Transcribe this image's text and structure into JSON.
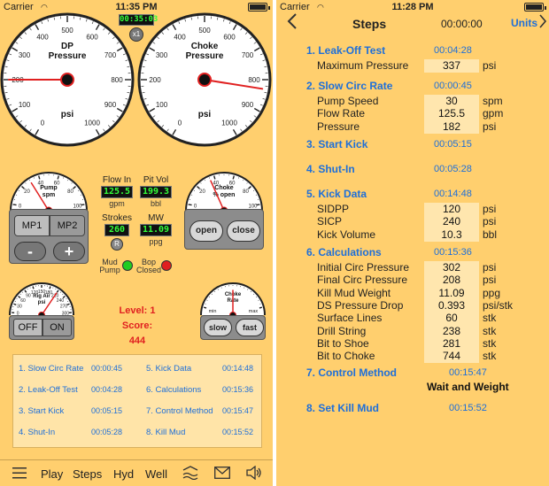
{
  "left_screen": {
    "status_bar": {
      "carrier": "Carrier",
      "time": "11:35 PM"
    },
    "timer": "00:35:03",
    "speed_multiplier": "x1",
    "dp_gauge": {
      "title_line1": "DP",
      "title_line2": "Pressure",
      "unit": "psi",
      "ticks": [
        "0",
        "100",
        "200",
        "300",
        "400",
        "500",
        "600",
        "700",
        "800",
        "900",
        "1000"
      ],
      "value": 200
    },
    "choke_gauge": {
      "title_line1": "Choke",
      "title_line2": "Pressure",
      "unit": "psi",
      "ticks": [
        "0",
        "100",
        "200",
        "300",
        "400",
        "500",
        "600",
        "700",
        "800",
        "900",
        "1000"
      ],
      "value": 830
    },
    "pump_gauge": {
      "title_line1": "Pump",
      "title_line2": "spm",
      "ticks": [
        "0",
        "20",
        "40",
        "60",
        "80",
        "100"
      ],
      "value": 30
    },
    "choke_open_gauge": {
      "title_line1": "Choke",
      "title_line2": "% open",
      "ticks": [
        "0",
        "20",
        "40",
        "60",
        "80",
        "100"
      ],
      "value": 35
    },
    "rig_air_gauge": {
      "title_line1": "Rig Air",
      "title_line2": "psi",
      "ticks": [
        "0",
        "30",
        "60",
        "90",
        "120",
        "150",
        "180",
        "210",
        "240",
        "270",
        "300"
      ],
      "value": 210
    },
    "choke_rate_gauge": {
      "title_line1": "Choke",
      "title_line2": "Rate",
      "min_label": "min",
      "max_label": "max",
      "value": 50
    },
    "flow_in": {
      "label": "Flow In",
      "value": "125.5",
      "unit": "gpm"
    },
    "pit_vol": {
      "label": "Pit Vol",
      "value": "199.3",
      "unit": "bbl"
    },
    "strokes": {
      "label": "Strokes",
      "value": "260",
      "reset_label": "R"
    },
    "mw": {
      "label": "MW",
      "value": "11.09",
      "unit": "ppg"
    },
    "mud_pump_led": {
      "label_line1": "Mud",
      "label_line2": "Pump",
      "color": "#22cc22"
    },
    "bop_closed_led": {
      "label_line1": "Bop",
      "label_line2": "Closed",
      "color": "#e02020"
    },
    "pump_controls": {
      "mp1": "MP1",
      "mp2": "MP2",
      "minus": "-",
      "plus": "+"
    },
    "choke_controls": {
      "open": "open",
      "close": "close"
    },
    "rig_air_toggle": {
      "off": "OFF",
      "on": "ON"
    },
    "choke_rate_controls": {
      "slow": "slow",
      "fast": "fast"
    },
    "level": {
      "label": "Level:",
      "value": "1"
    },
    "score": {
      "label": "Score:",
      "value": "444"
    },
    "accent_red": "#e02020",
    "steps": [
      {
        "label": "1. Slow Circ Rate",
        "time": "00:00:45"
      },
      {
        "label": "2. Leak-Off Test",
        "time": "00:04:28"
      },
      {
        "label": "3. Start Kick",
        "time": "00:05:15"
      },
      {
        "label": "4. Shut-In",
        "time": "00:05:28"
      },
      {
        "label": "5. Kick Data",
        "time": "00:14:48"
      },
      {
        "label": "6. Calculations",
        "time": "00:15:36"
      },
      {
        "label": "7. Control Method",
        "time": "00:15:47"
      },
      {
        "label": "8. Kill Mud",
        "time": "00:15:52"
      }
    ],
    "tab_bar": {
      "menu_icon": "menu-icon",
      "play": "Play",
      "steps": "Steps",
      "hyd": "Hyd",
      "well": "Well"
    }
  },
  "right_screen": {
    "status_bar": {
      "carrier": "Carrier",
      "time": "11:28 PM"
    },
    "nav": {
      "back_icon": "chevron-left-icon",
      "title": "Steps",
      "timer": "00:00:00",
      "units": "Units",
      "forward_icon": "chevron-right-icon"
    },
    "sections": [
      {
        "title": "1. Leak-Off Test",
        "time": "00:04:28",
        "rows": [
          {
            "label": "Maximum Pressure",
            "value": "337",
            "unit": "psi"
          }
        ]
      },
      {
        "title": "2. Slow Circ Rate",
        "time": "00:00:45",
        "rows": [
          {
            "label": "Pump Speed",
            "value": "30",
            "unit": "spm"
          },
          {
            "label": "Flow Rate",
            "value": "125.5",
            "unit": "gpm"
          },
          {
            "label": "Pressure",
            "value": "182",
            "unit": "psi"
          }
        ]
      },
      {
        "title": "3. Start Kick",
        "time": "00:05:15",
        "rows": []
      },
      {
        "title": "4. Shut-In",
        "time": "00:05:28",
        "rows": []
      },
      {
        "title": "5. Kick Data",
        "time": "00:14:48",
        "rows": [
          {
            "label": "SIDPP",
            "value": "120",
            "unit": "psi"
          },
          {
            "label": "SICP",
            "value": "240",
            "unit": "psi"
          },
          {
            "label": "Kick Volume",
            "value": "10.3",
            "unit": "bbl"
          }
        ]
      },
      {
        "title": "6. Calculations",
        "time": "00:15:36",
        "rows": [
          {
            "label": "Initial Circ Pressure",
            "value": "302",
            "unit": "psi"
          },
          {
            "label": "Final Circ Pressure",
            "value": "208",
            "unit": "psi"
          },
          {
            "label": "Kill Mud Weight",
            "value": "11.09",
            "unit": "ppg"
          },
          {
            "label": "DS Pressure Drop",
            "value": "0.393",
            "unit": "psi/stk"
          },
          {
            "label": "Surface Lines",
            "value": "60",
            "unit": "stk"
          },
          {
            "label": "Drill String",
            "value": "238",
            "unit": "stk"
          },
          {
            "label": "Bit to Shoe",
            "value": "281",
            "unit": "stk"
          },
          {
            "label": "Bit to Choke",
            "value": "744",
            "unit": "stk"
          }
        ]
      },
      {
        "title": "7. Control Method",
        "time": "00:15:47",
        "rows": [],
        "method": "Wait and Weight"
      },
      {
        "title": "8. Set Kill Mud",
        "time": "00:15:52",
        "rows": []
      }
    ]
  }
}
